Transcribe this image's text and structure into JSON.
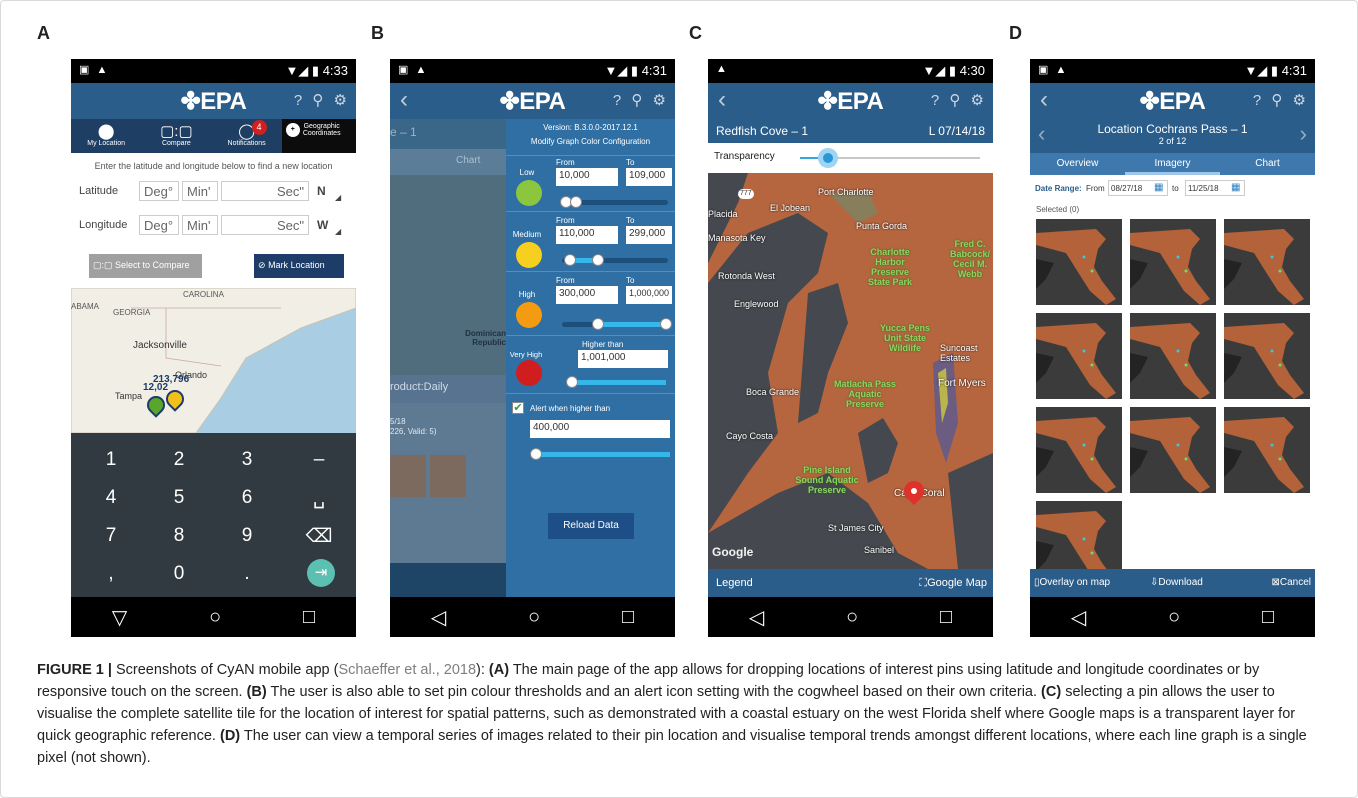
{
  "panels": {
    "a": "A",
    "b": "B",
    "c": "C",
    "d": "D"
  },
  "status": {
    "time_a": "4:33",
    "time_b": "4:31",
    "time_c": "4:30",
    "time_d": "4:31"
  },
  "app": {
    "brand": "EPA"
  },
  "phone_a": {
    "tabs": [
      "My Location",
      "Compare",
      "Notifications",
      "Geographic Coordinates"
    ],
    "notification_count": "4",
    "hint": "Enter the latitude and longitude below to find a new location",
    "latitude_label": "Latitude",
    "longitude_label": "Longitude",
    "deg": "Deg°",
    "min": "Min'",
    "sec": "Sec\"",
    "lat_dir": "N",
    "lon_dir": "W",
    "compare_button": "Select to Compare",
    "mark_button": "Mark Location",
    "map_labels": [
      "CAROLINA",
      "ABAMA",
      "GEORGIA",
      "Jacksonville",
      "Orlando",
      "Tampa",
      "12,02",
      "213,796"
    ],
    "keys": [
      "1",
      "2",
      "3",
      "–",
      "4",
      "5",
      "6",
      "␣",
      "7",
      "8",
      "9",
      "⌫",
      ",",
      "0",
      ".",
      "⇥"
    ]
  },
  "phone_b": {
    "version": "Version: B.3.0.0-2017.12.1",
    "modify": "Modify Graph Color Configuration",
    "bg_texts": [
      "e – 1",
      "Chart",
      "Dominican Republic",
      "roduct:Daily",
      "5/18",
      "226, Valid: 5)"
    ],
    "from": "From",
    "to": "To",
    "low": {
      "label": "Low",
      "from": "10,000",
      "to": "109,000",
      "color": "#8cc63f"
    },
    "medium": {
      "label": "Medium",
      "from": "110,000",
      "to": "299,000",
      "color": "#f7cf1e"
    },
    "high": {
      "label": "High",
      "from": "300,000",
      "to": "1,000,000",
      "color": "#f39c12"
    },
    "very_high": {
      "label": "Very High",
      "caption": "Higher than",
      "value": "1,001,000",
      "color": "#d01e1e"
    },
    "alert_label": "Alert when higher than",
    "alert_value": "400,000",
    "reload": "Reload Data"
  },
  "phone_c": {
    "title": "Redfish Cove – 1",
    "date": "L 07/14/18",
    "transparency": "Transparency",
    "map_labels": [
      "Port Charlotte",
      "Punta Gorda",
      "Charlotte Harbor Preserve State Park",
      "Fred C. Babcock/ Cecil M. Webb",
      "Yucca Pens Unit State Wildlife",
      "Suncoast Estates",
      "Fort Myers",
      "Matlacha Pass Aquatic Preserve",
      "Pine Island Sound Aquatic Preserve",
      "Cape Coral",
      "Cayo Costa",
      "Boca Grande",
      "Rotonda West",
      "Placida",
      "Englewood",
      "El Jobean",
      "Manasota Key",
      "St James City",
      "Sanibel",
      "Google"
    ],
    "legend": "Legend",
    "google_map": "Google Map"
  },
  "phone_d": {
    "title": "Location Cochrans Pass – 1",
    "subtitle": "2 of 12",
    "tabs": [
      "Overview",
      "Imagery",
      "Chart"
    ],
    "date_range_label": "Date Range:",
    "from_label": "From",
    "from_date": "08/27/18",
    "to_label": "to",
    "to_date": "11/25/18",
    "selected": "Selected (0)",
    "overlay": "Overlay on map",
    "download": "Download",
    "cancel": "Cancel"
  },
  "caption": {
    "fig": "FIGURE 1 |",
    "intro": " Screenshots of CyAN mobile app (",
    "ref": "Schaeffer et al., 2018",
    "intro_end": "): ",
    "a_tag": "(A)",
    "a_text": " The main page of the app allows for dropping locations of interest pins using latitude and longitude coordinates or by responsive touch on the screen. ",
    "b_tag": "(B)",
    "b_text": " The user is also able to set pin colour thresholds and an alert icon setting with the cogwheel based on their own criteria. ",
    "c_tag": "(C)",
    "c_text": " selecting a pin allows the user to visualise the complete satellite tile for the location of interest for spatial patterns, such as demonstrated with a coastal estuary on the west Florida shelf where Google maps is a transparent layer for quick geographic reference. ",
    "d_tag": "(D)",
    "d_text": " The user can view a temporal series of images related to their pin location and visualise temporal trends amongst different locations, where each line graph is a single pixel (not shown)."
  }
}
